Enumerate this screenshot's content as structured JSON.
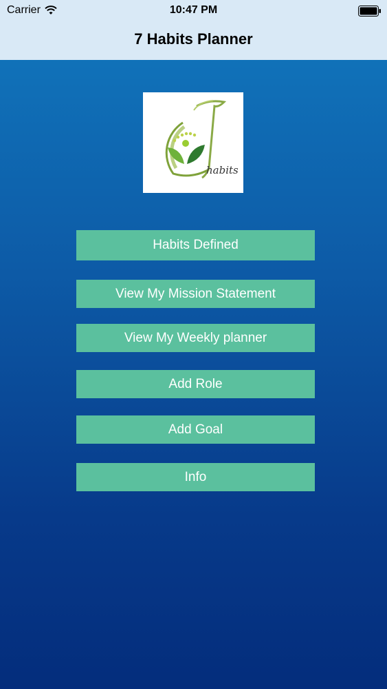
{
  "status_bar": {
    "carrier": "Carrier",
    "time": "10:47 PM",
    "wifi_icon": "wifi-icon",
    "battery_icon": "battery-icon"
  },
  "nav": {
    "title": "7 Habits Planner"
  },
  "logo": {
    "text": "habits",
    "icon": "7-habits-logo"
  },
  "menu": {
    "habits_defined": "Habits Defined",
    "mission_statement": "View My Mission Statement",
    "weekly_planner": "View My Weekly planner",
    "add_role": "Add Role",
    "add_goal": "Add Goal",
    "info": "Info"
  },
  "colors": {
    "button": "#5bc09e",
    "topbar": "#d9e9f6",
    "background_top": "#1178be",
    "background_bottom": "#042d7c"
  }
}
